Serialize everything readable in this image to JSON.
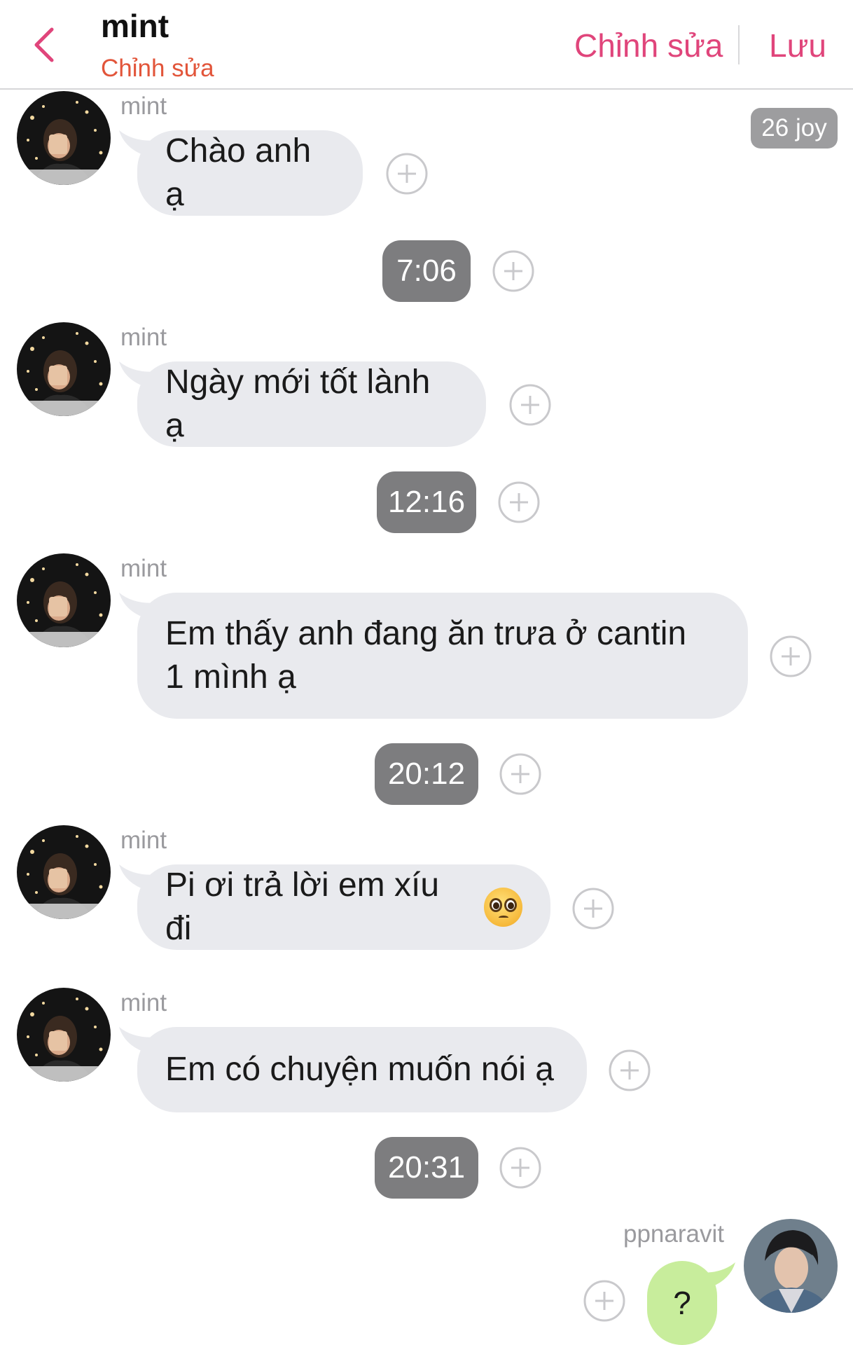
{
  "header": {
    "title": "mint",
    "subtitle": "Chỉnh sửa",
    "edit_label": "Chỉnh sửa",
    "save_label": "Lưu",
    "accent_color": "#e0457b",
    "subtitle_color": "#e2553a"
  },
  "joy_badge": "26 joy",
  "messages": [
    {
      "sender": "mint",
      "text": "Chào anh ạ"
    },
    {
      "sender": "mint",
      "text": "Ngày mới tốt lành ạ"
    },
    {
      "sender": "mint",
      "text": "Em thấy anh đang ăn trưa ở cantin 1 mình ạ"
    },
    {
      "sender": "mint",
      "text": "Pi ơi trả lời em xíu đi"
    },
    {
      "sender": "mint",
      "text": "Em có chuyện muốn nói ạ"
    }
  ],
  "times": [
    "7:06",
    "12:16",
    "20:12",
    "20:31"
  ],
  "reply": {
    "sender": "ppnaravit",
    "text": "?",
    "bubble_color": "#c8ed9c"
  },
  "icons": {
    "back": "chevron-left-icon",
    "add": "plus-circle-icon",
    "emoji": "pleading-face-emoji"
  }
}
